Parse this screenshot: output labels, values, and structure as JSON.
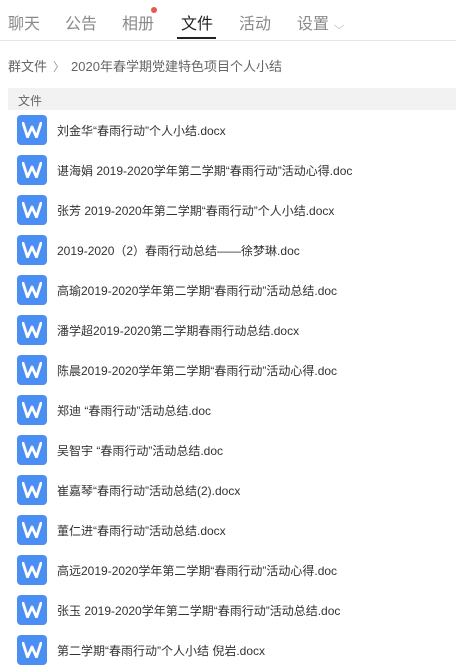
{
  "tabs": [
    {
      "label": "聊天"
    },
    {
      "label": "公告"
    },
    {
      "label": "相册"
    },
    {
      "label": "文件"
    },
    {
      "label": "活动"
    },
    {
      "label": "设置"
    }
  ],
  "active_tab": "文件",
  "breadcrumb": {
    "root": "群文件",
    "current": "2020年春学期党建特色项目个人小结"
  },
  "list_header": "文件",
  "files": [
    {
      "name": "刘金华“春雨行动”个人小结.docx"
    },
    {
      "name": "谌海娟 2019-2020学年第二学期“春雨行动”活动心得.doc"
    },
    {
      "name": "张芳 2019-2020年第二学期“春雨行动”个人小结.docx"
    },
    {
      "name": "2019-2020（2）春雨行动总结——徐梦琳.doc"
    },
    {
      "name": "高瑜2019-2020学年第二学期“春雨行动”活动总结.doc"
    },
    {
      "name": "潘学超2019-2020第二学期春雨行动总结.docx"
    },
    {
      "name": "陈晨2019-2020学年第二学期“春雨行动”活动心得.doc"
    },
    {
      "name": "郑迪 “春雨行动”活动总结.doc"
    },
    {
      "name": "吴智宇 “春雨行动”活动总结.doc"
    },
    {
      "name": "崔嘉琴“春雨行动”活动总结(2).docx"
    },
    {
      "name": "董仁进“春雨行动”活动总结.docx"
    },
    {
      "name": "高远2019-2020学年第二学期“春雨行动”活动心得.doc"
    },
    {
      "name": "张玉 2019-2020学年第二学期“春雨行动”活动总结.doc"
    },
    {
      "name": "第二学期“春雨行动”个人小结 倪岩.docx"
    }
  ],
  "icons": {
    "file": "word-doc-icon",
    "settings_dropdown": "chevron-down-icon",
    "breadcrumb_separator": "chevron-right-icon"
  },
  "colors": {
    "accent_icon": "#4b8ef4",
    "badge": "#e8584f",
    "active_tab": "#222222",
    "inactive_tab": "#8a8a8a"
  }
}
